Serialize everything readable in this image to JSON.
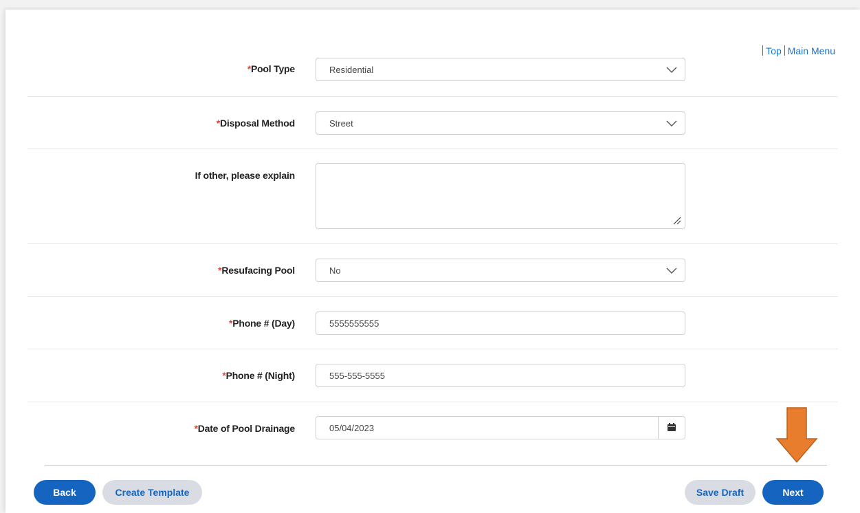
{
  "links": {
    "top": "Top",
    "main_menu": "Main Menu"
  },
  "required_marker": "*",
  "fields": {
    "pool_type": {
      "label": "Pool Type",
      "value": "Residential"
    },
    "disposal_method": {
      "label": "Disposal Method",
      "value": "Street"
    },
    "other_explain": {
      "label": "If other, please explain",
      "value": ""
    },
    "resurfacing_pool": {
      "label": "Resufacing Pool",
      "value": "No"
    },
    "phone_day": {
      "label": "Phone # (Day)",
      "value": "5555555555"
    },
    "phone_night": {
      "label": "Phone # (Night)",
      "value": "555-555-5555"
    },
    "drainage_date": {
      "label": "Date of Pool Drainage",
      "value": "05/04/2023"
    }
  },
  "buttons": {
    "back": "Back",
    "create_template": "Create Template",
    "save_draft": "Save Draft",
    "next": "Next"
  },
  "colors": {
    "primary": "#1565c0",
    "required": "#e0463c",
    "annotation_arrow": "#e87d2e",
    "secondary_button": "#d9dde3"
  },
  "icons": [
    "chevron-down-icon",
    "calendar-icon",
    "resize-handle-icon",
    "down-arrow-annotation"
  ]
}
